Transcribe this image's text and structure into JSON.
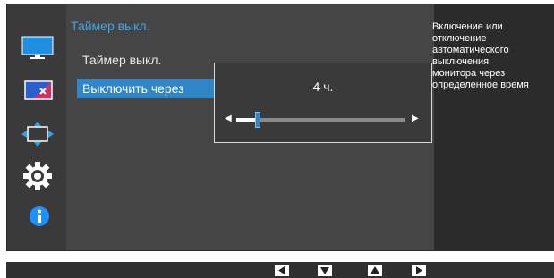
{
  "menu": {
    "title": "Таймер выкл.",
    "items": [
      {
        "label": "Таймер выкл."
      },
      {
        "label": "Выключить через"
      }
    ]
  },
  "submenu": {
    "value": "4 ч.",
    "slider_fraction": 0.13
  },
  "help": {
    "text": "Включение или\nотключение\nавтоматического\nвыключения\nмонитора через\nопределенное время"
  },
  "icons": [
    "picture-icon",
    "color-icon",
    "size-position-icon",
    "settings-icon",
    "info-icon"
  ],
  "bottom_buttons": [
    "left-button-icon",
    "down-button-icon",
    "up-button-icon",
    "right-button-icon"
  ],
  "colors": {
    "accent": "#2f86c8",
    "title": "#3fa6e6",
    "panel": "#454545"
  }
}
